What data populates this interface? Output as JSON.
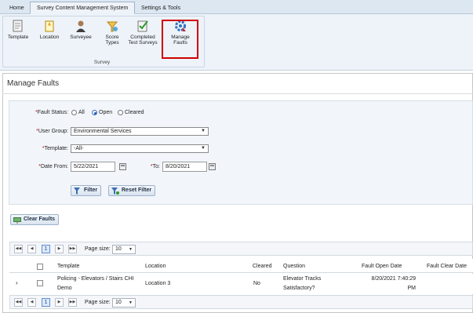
{
  "tabs": [
    "Home",
    "Survey Content Management System",
    "Settings & Tools"
  ],
  "ribbon": {
    "tools": [
      {
        "label": "Template",
        "icon": "template-icon"
      },
      {
        "label": "Location",
        "icon": "location-icon"
      },
      {
        "label": "Surveyee",
        "icon": "surveyee-icon"
      },
      {
        "label": "Score\nTypes",
        "icon": "score-types-icon"
      },
      {
        "label": "Completed\nTest Surveys",
        "icon": "completed-test-surveys-icon"
      },
      {
        "label": "Manage\nFaults",
        "icon": "manage-faults-icon"
      }
    ],
    "group_label": "Survey",
    "highlight_color": "#d10000"
  },
  "page": {
    "title": "Manage Faults",
    "filters": {
      "fault_status_label": "Fault Status:",
      "fault_status_options": [
        "All",
        "Open",
        "Cleared"
      ],
      "fault_status_selected": "Open",
      "user_group_label": "User Group:",
      "user_group_value": "Environmental Services",
      "template_label": "Template:",
      "template_value": "-All-",
      "date_from_label": "Date From:",
      "date_from_value": "5/22/2021",
      "to_label": "To:",
      "to_value": "8/20/2021",
      "required_mark": "*"
    },
    "buttons": {
      "filter": "Filter",
      "reset_filter": "Reset Filter",
      "clear_faults": "Clear Faults"
    }
  },
  "grid": {
    "pager": {
      "current_page": "1",
      "page_size_label": "Page size:",
      "page_size": "10"
    },
    "columns": [
      "Template",
      "Location",
      "Cleared",
      "Question",
      "Fault Open Date",
      "Fault Clear Date"
    ],
    "rows": [
      {
        "template_line1": "Policing - Elevators / Stairs CHI",
        "template_line2": "Demo",
        "location": "Location 3",
        "cleared": "No",
        "question_line1": "Elevator Tracks",
        "question_line2": "Satisfactory?",
        "open_date_line1": "8/20/2021 7:40:29",
        "open_date_line2": "PM",
        "clear_date": ""
      }
    ]
  }
}
